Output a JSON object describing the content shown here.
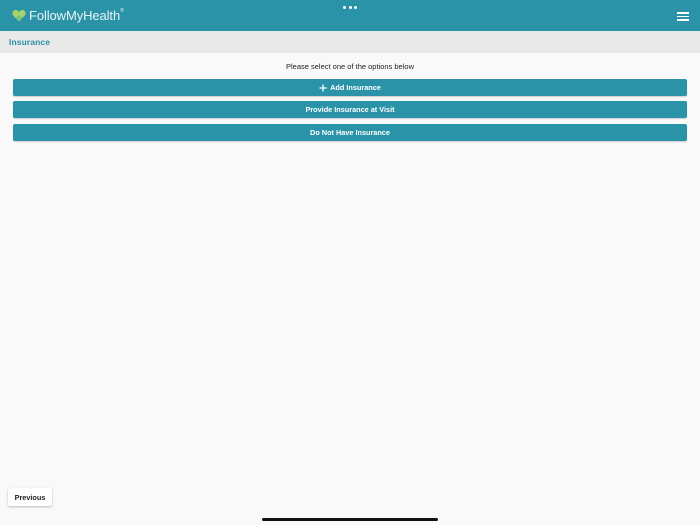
{
  "app": {
    "logo_text": "FollowMyHealth",
    "logo_mark": "®"
  },
  "header": {
    "title": "Insurance"
  },
  "main": {
    "instruction": "Please select one of the options below",
    "options": [
      {
        "label": "Add Insurance",
        "icon": "plus-icon"
      },
      {
        "label": "Provide Insurance at Visit"
      },
      {
        "label": "Do Not Have Insurance"
      }
    ]
  },
  "footer": {
    "previous_label": "Previous"
  },
  "colors": {
    "brand": "#2a93a8",
    "title_text": "#2a8fa7",
    "title_bar": "#e9e9e9",
    "background": "#f9f9f9",
    "logo_heart": "#a6d36b"
  }
}
